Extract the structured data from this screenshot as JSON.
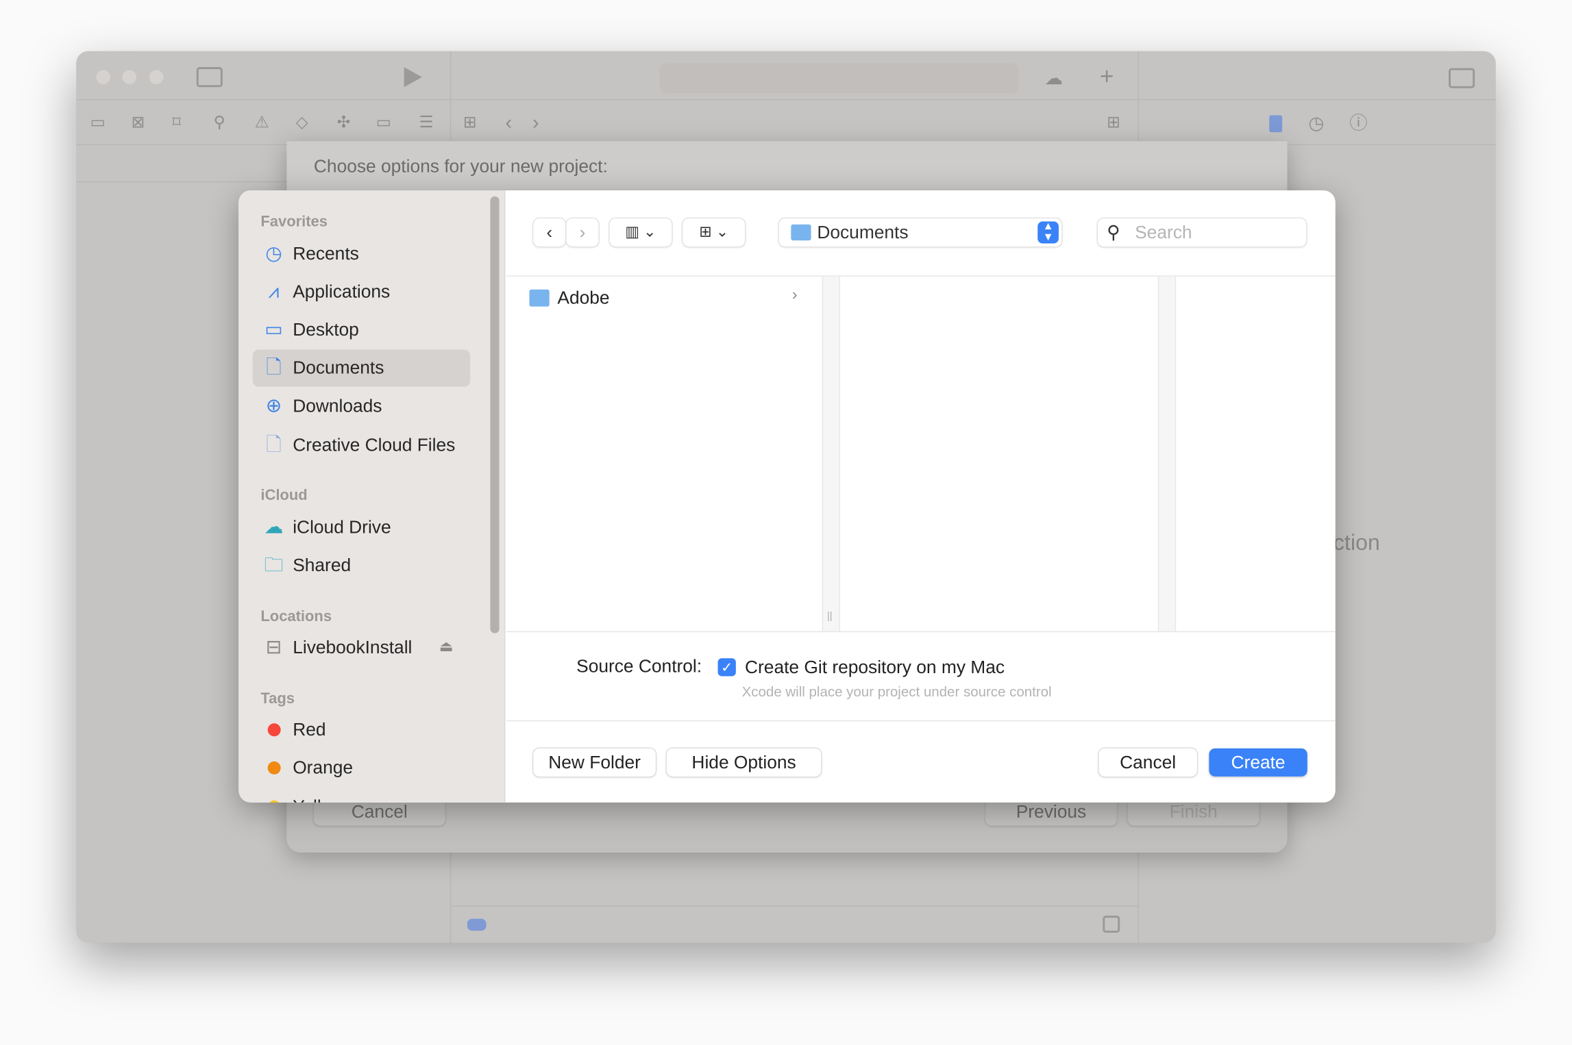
{
  "background_window": {
    "sheet_title": "Choose options for your new project:",
    "sheet_buttons": {
      "cancel": "Cancel",
      "previous": "Previous",
      "finish": "Finish"
    },
    "partial_text": "ction"
  },
  "dialog": {
    "sidebar": {
      "sections": [
        {
          "header": "Favorites",
          "items": [
            {
              "label": "Recents",
              "icon": "clock-icon"
            },
            {
              "label": "Applications",
              "icon": "app-store-icon"
            },
            {
              "label": "Desktop",
              "icon": "desktop-icon"
            },
            {
              "label": "Documents",
              "icon": "document-icon",
              "selected": true
            },
            {
              "label": "Downloads",
              "icon": "download-icon"
            },
            {
              "label": "Creative Cloud Files",
              "icon": "file-icon"
            }
          ]
        },
        {
          "header": "iCloud",
          "items": [
            {
              "label": "iCloud Drive",
              "icon": "cloud-icon"
            },
            {
              "label": "Shared",
              "icon": "shared-folder-icon"
            }
          ]
        },
        {
          "header": "Locations",
          "items": [
            {
              "label": "LivebookInstall",
              "icon": "drive-icon"
            }
          ]
        },
        {
          "header": "Tags",
          "items": [
            {
              "label": "Red",
              "color": "#f5483b"
            },
            {
              "label": "Orange",
              "color": "#f08a12"
            },
            {
              "label": "Yellow",
              "color": "#f5c518"
            }
          ]
        }
      ]
    },
    "toolbar": {
      "location": "Documents",
      "search_placeholder": "Search"
    },
    "columns": [
      {
        "items": [
          {
            "name": "Adobe",
            "icon": "folder-icon"
          }
        ]
      }
    ],
    "options": {
      "source_control_label": "Source Control:",
      "git_checkbox_label": "Create Git repository on my Mac",
      "git_checked": true,
      "hint": "Xcode will place your project under source control"
    },
    "buttons": {
      "new_folder": "New Folder",
      "hide_options": "Hide Options",
      "cancel": "Cancel",
      "create": "Create"
    },
    "accent_color": "#3a82f7"
  }
}
